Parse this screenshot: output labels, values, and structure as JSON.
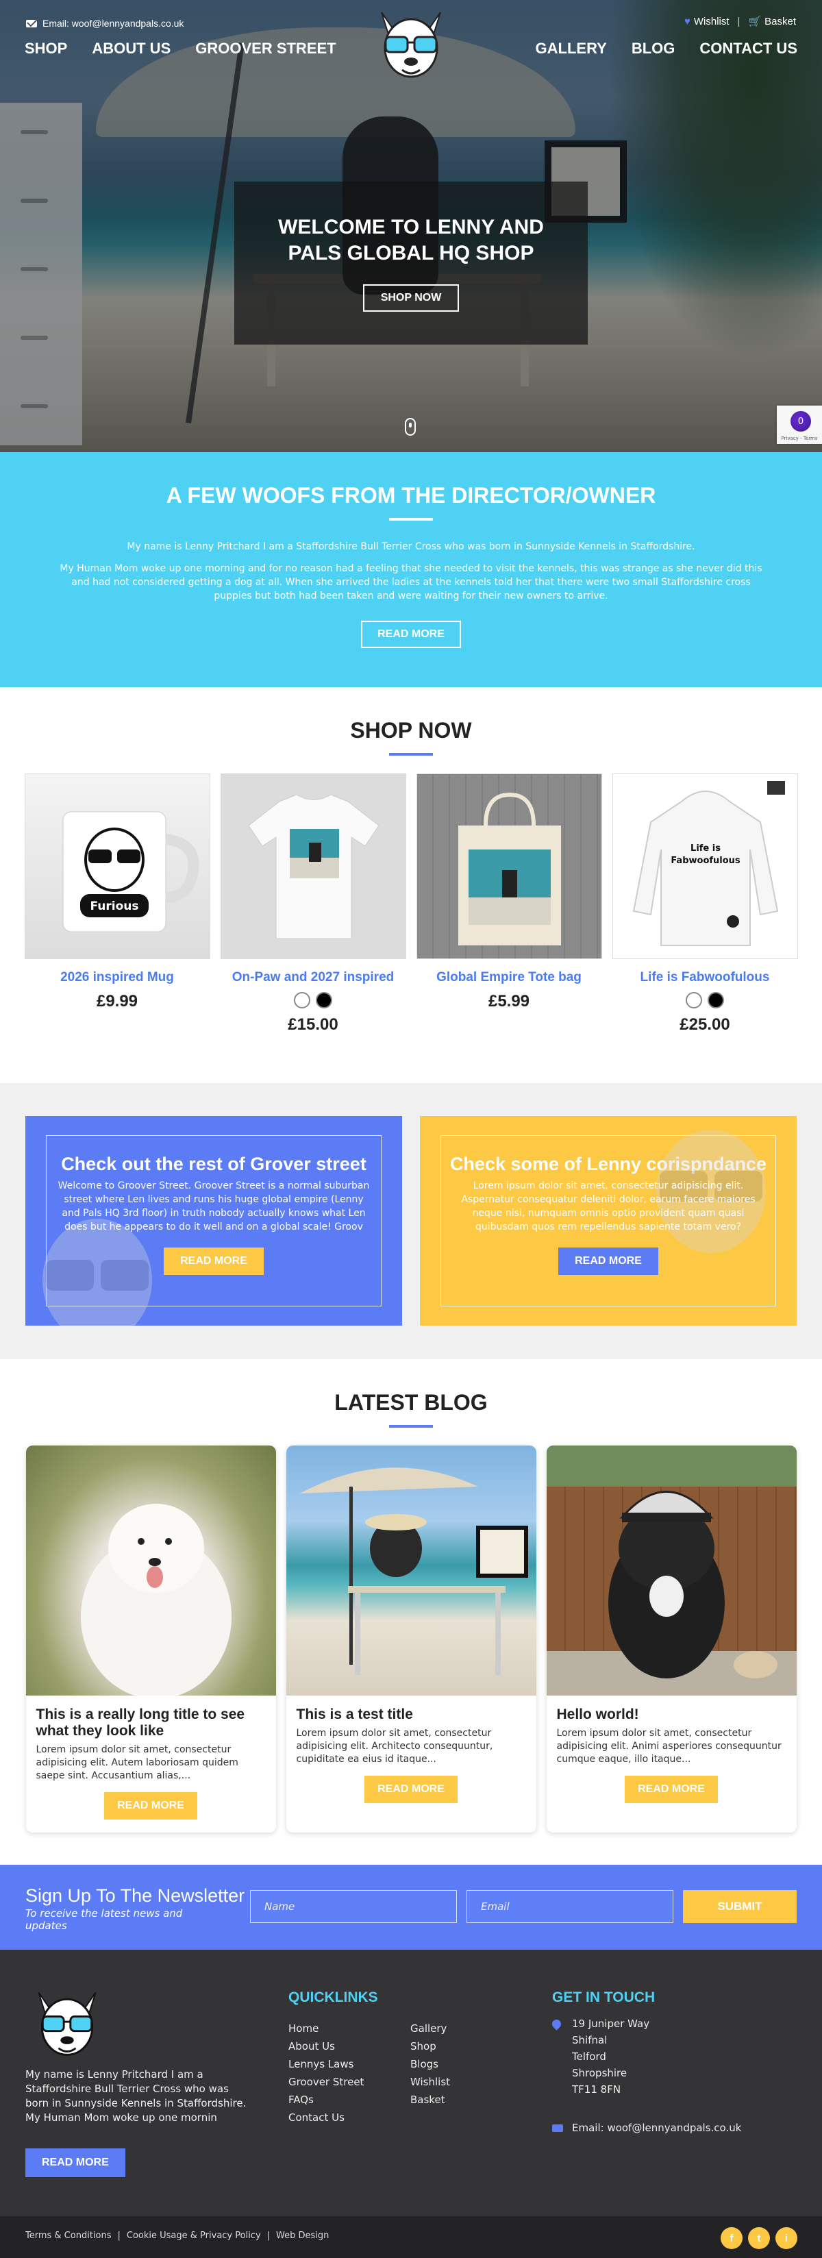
{
  "header": {
    "email": "Email: woof@lennyandpals.co.uk",
    "nav_left": [
      "SHOP",
      "ABOUT US",
      "GROOVER STREET"
    ],
    "nav_right": [
      "GALLERY",
      "BLOG",
      "CONTACT US"
    ],
    "wishlist": "Wishlist",
    "basket": "Basket",
    "logo_icon": "bull-terrier-sunglasses-logo"
  },
  "hero": {
    "title": "WELCOME TO LENNY AND PALS GLOBAL HQ SHOP",
    "button": "SHOP NOW",
    "recaptcha_count": "0",
    "recaptcha_text": "Privacy - Terms"
  },
  "about": {
    "title": "A FEW WOOFS FROM THE DIRECTOR/OWNER",
    "para1": "My name is Lenny Pritchard I am a Staffordshire Bull Terrier Cross who was born in Sunnyside Kennels in Staffordshire.",
    "para2": "My Human Mom woke up one morning and for no reason had a feeling that she needed to visit the kennels, this was strange as she never did this and had not considered getting a dog at all. When she arrived the ladies at the kennels told her that there were two small Staffordshire cross puppies but both had been taken and were waiting for their new owners to arrive.",
    "button": "READ MORE"
  },
  "shop": {
    "title": "SHOP NOW",
    "products": [
      {
        "name": "2026 inspired Mug",
        "price": "£9.99",
        "swatches": [],
        "image": "mug-image"
      },
      {
        "name": "On-Paw and 2027 inspired",
        "price": "£15.00",
        "swatches": [
          "#ffffff",
          "#000000"
        ],
        "image": "tshirt-image"
      },
      {
        "name": "Global Empire Tote bag",
        "price": "£5.99",
        "swatches": [],
        "image": "tote-bag-image"
      },
      {
        "name": "Life is Fabwoofulous",
        "price": "£25.00",
        "swatches": [
          "#ffffff",
          "#000000"
        ],
        "image": "hoodie-image"
      }
    ]
  },
  "cta": {
    "left": {
      "title": "Check out the rest of Grover street",
      "text": "Welcome to Groover Street. Groover Street is a normal suburban street where Len lives and runs his huge global empire (Lenny and Pals HQ 3rd floor) in truth nobody actually knows what Len does but he appears to do it well and on a global scale! Groov",
      "button": "READ MORE"
    },
    "right": {
      "title": "Check some of Lenny corispndance",
      "text": "Lorem ipsum dolor sit amet, consectetur adipisicing elit. Aspernatur consequatur deleniti dolor, earum facere maiores neque nisi, numquam omnis optio provident quam quasi quibusdam quos rem repellendus sapiente totam vero?",
      "button": "READ MORE"
    }
  },
  "blog": {
    "title": "LATEST BLOG",
    "posts": [
      {
        "title": "This is a really long title to see what they look like",
        "excerpt": "Lorem ipsum dolor sit amet, consectetur adipisicing elit. Autem laboriosam quidem saepe sint. Accusantium alias,...",
        "button": "READ MORE"
      },
      {
        "title": "This is a test title",
        "excerpt": "Lorem ipsum dolor sit amet, consectetur adipisicing elit. Architecto consequuntur, cupiditate ea eius id itaque...",
        "button": "READ MORE"
      },
      {
        "title": "Hello world!",
        "excerpt": "Lorem ipsum dolor sit amet, consectetur adipisicing elit. Animi asperiores consequuntur cumque eaque, illo itaque...",
        "button": "READ MORE"
      }
    ]
  },
  "newsletter": {
    "title": "Sign Up To The Newsletter",
    "subtitle": "To receive the latest news and updates",
    "name_placeholder": "Name",
    "email_placeholder": "Email",
    "submit": "SUBMIT"
  },
  "footer": {
    "about": "My name is Lenny Pritchard I am a Staffordshire Bull Terrier Cross who was born in Sunnyside Kennels in Staffordshire. My Human Mom woke up one mornin",
    "button": "READ MORE",
    "quicklinks_title": "QUICKLINKS",
    "quicklinks_col1": [
      "Home",
      "About Us",
      "Lennys Laws",
      "Groover Street",
      "FAQs",
      "Contact Us"
    ],
    "quicklinks_col2": [
      "Gallery",
      "Shop",
      "Blogs",
      "Wishlist",
      "Basket"
    ],
    "contact_title": "GET IN TOUCH",
    "address": [
      "19 Juniper Way",
      "Shifnal",
      "Telford",
      "Shropshire",
      "TF11 8FN"
    ],
    "email": "Email: woof@lennyandpals.co.uk"
  },
  "bottom": {
    "links": [
      "Terms & Conditions",
      "Cookie Usage & Privacy Policy",
      "Web Design"
    ],
    "socials": [
      "f",
      "t",
      "i"
    ]
  },
  "colors": {
    "accent_blue": "#5b7cf5",
    "cyan": "#4fd1f4",
    "yellow": "#fdc844",
    "footer_bg": "#343336"
  }
}
